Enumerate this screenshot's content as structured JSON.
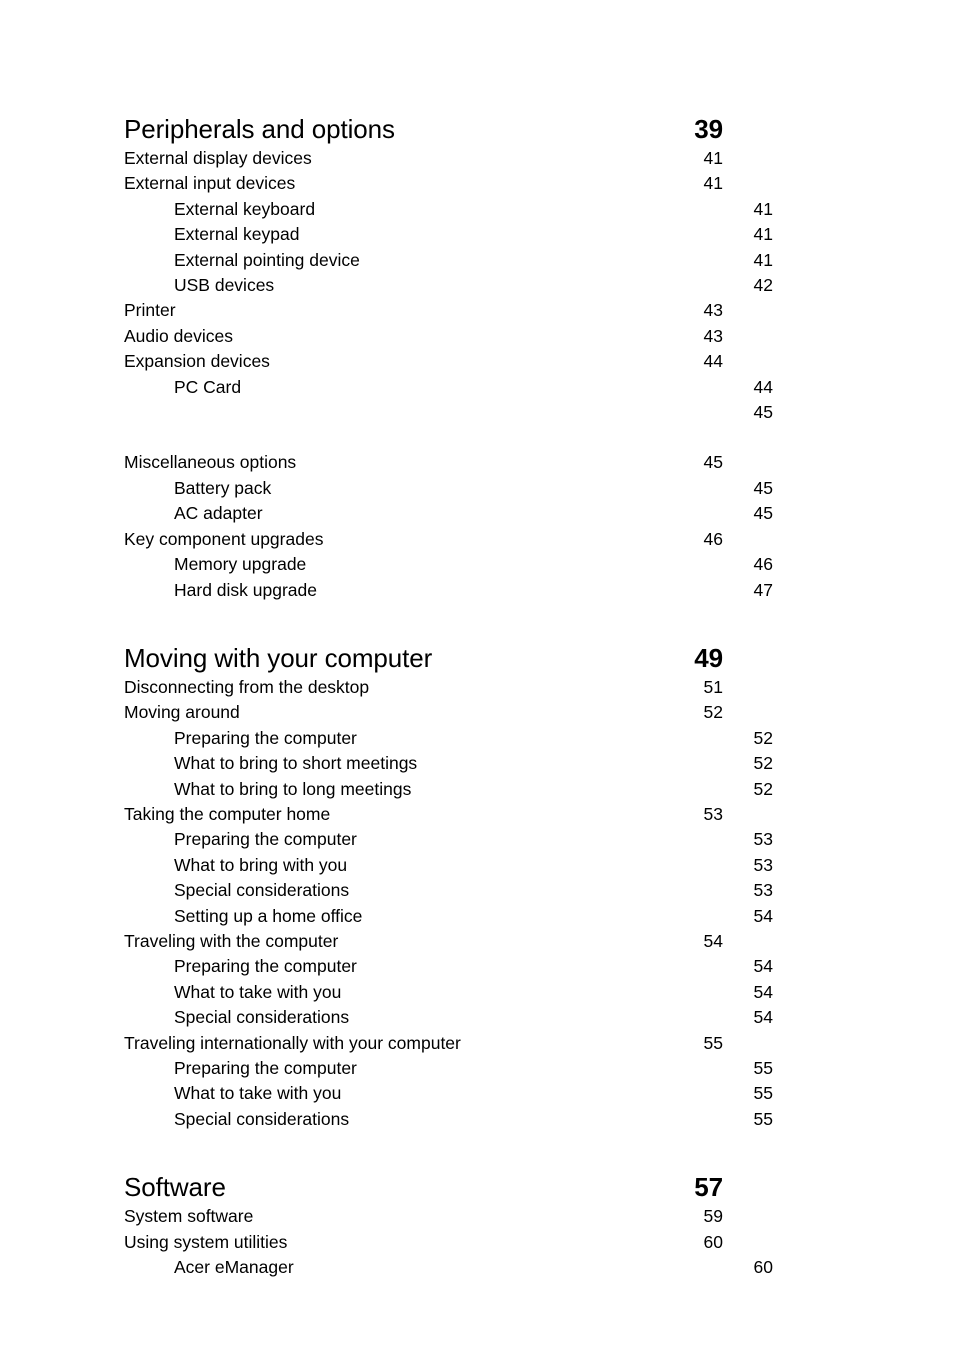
{
  "document": {
    "type": "table-of-contents",
    "background_color": "#ffffff",
    "text_color": "#000000"
  },
  "entries": [
    {
      "label": "Peripherals and options",
      "page": "39",
      "level": 0,
      "spaced": false
    },
    {
      "label": "External display devices",
      "page": "41",
      "level": 1
    },
    {
      "label": "External input devices",
      "page": "41",
      "level": 1
    },
    {
      "label": "External keyboard",
      "page": "41",
      "level": 2
    },
    {
      "label": "External keypad",
      "page": "41",
      "level": 2
    },
    {
      "label": "External pointing device",
      "page": "41",
      "level": 2
    },
    {
      "label": "USB devices",
      "page": "42",
      "level": 2
    },
    {
      "label": "Printer",
      "page": "43",
      "level": 1
    },
    {
      "label": "Audio devices",
      "page": "43",
      "level": 1
    },
    {
      "label": "Expansion devices",
      "page": "44",
      "level": 1
    },
    {
      "label": "PC Card",
      "page": "44",
      "level": 2
    },
    {
      "label": "",
      "page": "45",
      "level": 2,
      "gap_after": true
    },
    {
      "label": "Miscellaneous options",
      "page": "45",
      "level": 1
    },
    {
      "label": "Battery pack",
      "page": "45",
      "level": 2
    },
    {
      "label": "AC adapter",
      "page": "45",
      "level": 2
    },
    {
      "label": "Key component upgrades",
      "page": "46",
      "level": 1
    },
    {
      "label": "Memory upgrade",
      "page": "46",
      "level": 2
    },
    {
      "label": "Hard disk upgrade",
      "page": "47",
      "level": 2
    },
    {
      "label": "Moving with your computer",
      "page": "49",
      "level": 0,
      "spaced": true
    },
    {
      "label": "Disconnecting from the desktop",
      "page": "51",
      "level": 1
    },
    {
      "label": "Moving around",
      "page": "52",
      "level": 1
    },
    {
      "label": "Preparing the computer",
      "page": "52",
      "level": 2
    },
    {
      "label": "What to bring to short meetings",
      "page": "52",
      "level": 2
    },
    {
      "label": "What to bring to long meetings",
      "page": "52",
      "level": 2
    },
    {
      "label": "Taking the computer home",
      "page": "53",
      "level": 1
    },
    {
      "label": "Preparing the computer",
      "page": "53",
      "level": 2
    },
    {
      "label": "What to bring with you",
      "page": "53",
      "level": 2
    },
    {
      "label": "Special considerations",
      "page": "53",
      "level": 2
    },
    {
      "label": "Setting up a home office",
      "page": "54",
      "level": 2
    },
    {
      "label": "Traveling with the computer",
      "page": "54",
      "level": 1
    },
    {
      "label": "Preparing the computer",
      "page": "54",
      "level": 2
    },
    {
      "label": "What to take with you",
      "page": "54",
      "level": 2
    },
    {
      "label": "Special considerations",
      "page": "54",
      "level": 2
    },
    {
      "label": "Traveling internationally with your computer",
      "page": "55",
      "level": 1
    },
    {
      "label": "Preparing the computer",
      "page": "55",
      "level": 2
    },
    {
      "label": "What to take with you",
      "page": "55",
      "level": 2
    },
    {
      "label": "Special considerations",
      "page": "55",
      "level": 2
    },
    {
      "label": "Software",
      "page": "57",
      "level": 0,
      "spaced": true
    },
    {
      "label": "System software",
      "page": "59",
      "level": 1
    },
    {
      "label": "Using system utilities",
      "page": "60",
      "level": 1
    },
    {
      "label": "Acer eManager",
      "page": "60",
      "level": 2
    }
  ]
}
